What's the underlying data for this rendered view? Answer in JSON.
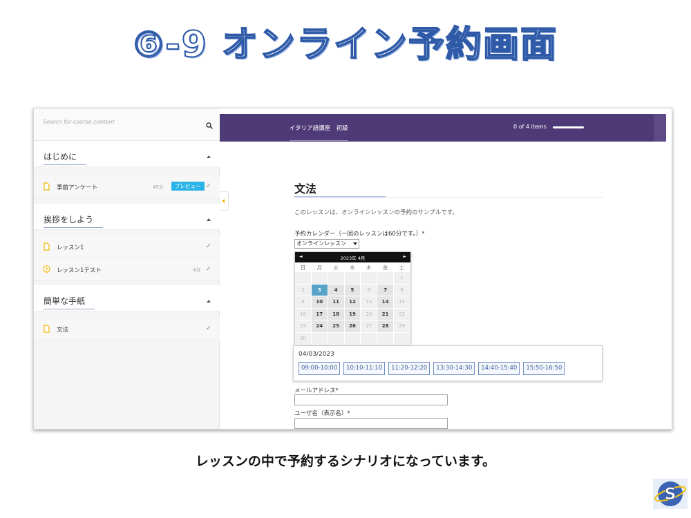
{
  "slide": {
    "title": "⑥-9 オンライン予約画面",
    "caption": "レッスンの中で予約するシナリオになっています。"
  },
  "sidebar": {
    "search_placeholder": "Search for course content",
    "sections": [
      {
        "title": "はじめに",
        "items": [
          {
            "label": "事前アンケート",
            "duration": "45分",
            "badge": "プレビュー",
            "icon": "document-icon"
          }
        ]
      },
      {
        "title": "挨拶をしよう",
        "items": [
          {
            "label": "レッスン1",
            "duration": "",
            "icon": "document-icon"
          },
          {
            "label": "レッスン1テスト",
            "duration": "4分",
            "icon": "question-icon"
          }
        ]
      },
      {
        "title": "簡単な手紙",
        "items": [
          {
            "label": "文法",
            "duration": "",
            "icon": "document-icon"
          }
        ]
      }
    ]
  },
  "topbar": {
    "course_title": "イタリア語講座　初級",
    "progress_text": "0 of 4 items",
    "progress": 0
  },
  "lesson": {
    "title": "文法",
    "intro": "このレッスンは、オンラインレッスンの予約のサンプルです。",
    "calendar_label": "予約カレンダー（一回のレッスンは60分です。）*",
    "calendar_select": "オンラインレッスン",
    "calendar": {
      "month": "2023年 4月",
      "prev": "◄",
      "next": "►",
      "weekdays": [
        "日",
        "月",
        "火",
        "水",
        "木",
        "金",
        "土"
      ],
      "weeks": [
        [
          "",
          "",
          "",
          "",
          "",
          "",
          "1"
        ],
        [
          "2",
          "3",
          "4",
          "5",
          "6",
          "7",
          "8"
        ],
        [
          "9",
          "10",
          "11",
          "12",
          "13",
          "14",
          "15"
        ],
        [
          "16",
          "17",
          "18",
          "19",
          "20",
          "21",
          "22"
        ],
        [
          "23",
          "24",
          "25",
          "26",
          "27",
          "28",
          "29"
        ],
        [
          "30",
          "",
          "",
          "",
          "",
          "",
          ""
        ]
      ],
      "available_days": [
        "4",
        "5",
        "7",
        "10",
        "11",
        "12",
        "14",
        "17",
        "18",
        "19",
        "21",
        "24",
        "25",
        "26",
        "28"
      ],
      "selected_day": "3"
    },
    "selected_date": "04/03/2023",
    "time_slots": [
      "09:00-10:00",
      "10:10-11:10",
      "11:20-12:20",
      "13:30-14:30",
      "14:40-15:40",
      "15:50-16:50"
    ],
    "email_label": "メールアドレス*",
    "username_label": "ユーザ名（表示名）*"
  },
  "colors": {
    "topbar": "#4f3a78",
    "badge": "#2ab3e7",
    "selected_day": "#5aa3c8",
    "slot_border": "#6f8fc4",
    "title_outline": "#2f5aa8"
  }
}
